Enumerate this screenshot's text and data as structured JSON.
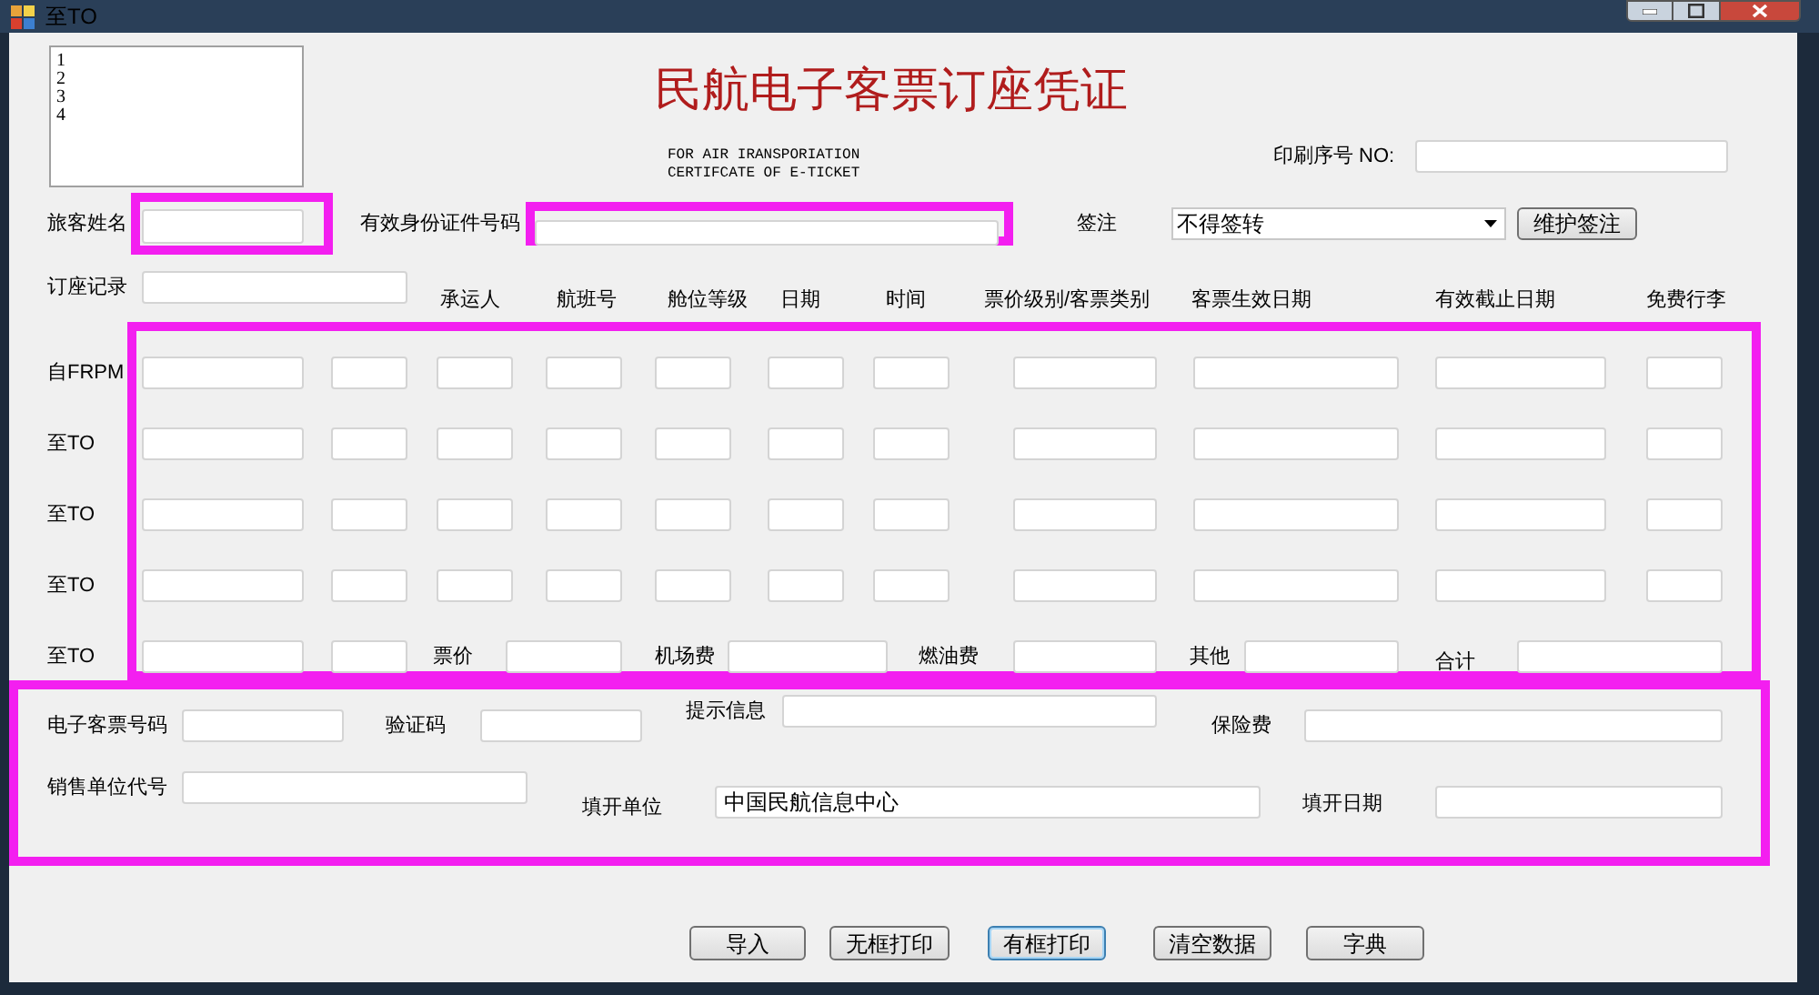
{
  "window": {
    "title": "至TO"
  },
  "list_box": {
    "items": [
      "1",
      "2",
      "3",
      "4"
    ]
  },
  "header": {
    "title": "民航电子客票订座凭证",
    "subtitle_lines": [
      "FOR AIR IRANSPORIATION",
      "CERTIFCATE OF E-TICKET"
    ]
  },
  "print_no": {
    "label": "印刷序号 NO:"
  },
  "passenger_name": {
    "label": "旅客姓名",
    "highlighted": true
  },
  "id_number": {
    "label": "有效身份证件号码",
    "highlighted": true
  },
  "endorsement": {
    "label": "签注",
    "value": "不得签转",
    "button": "维护签注"
  },
  "booking_record": {
    "label": "订座记录"
  },
  "columns": [
    "承运人",
    "航班号",
    "舱位等级",
    "日期",
    "时间",
    "票价级别/客票类别",
    "客票生效日期",
    "有效截止日期",
    "免费行李"
  ],
  "segments": {
    "highlighted": true,
    "rows": [
      {
        "label": "自FRPM"
      },
      {
        "label": "至TO"
      },
      {
        "label": "至TO"
      },
      {
        "label": "至TO"
      },
      {
        "label": "至TO"
      }
    ]
  },
  "fares": [
    {
      "label": "票价"
    },
    {
      "label": "机场费"
    },
    {
      "label": "燃油费"
    },
    {
      "label": "其他"
    },
    {
      "label": "合计"
    }
  ],
  "ticket_info": {
    "highlighted": true,
    "fields": [
      {
        "label": "电子客票号码"
      },
      {
        "label": "验证码"
      },
      {
        "label": "提示信息"
      },
      {
        "label": "保险费"
      },
      {
        "label": "销售单位代号"
      },
      {
        "label": "填开单位",
        "value": "中国民航信息中心"
      },
      {
        "label": "填开日期"
      }
    ]
  },
  "buttons": [
    {
      "label": "导入",
      "focused": false
    },
    {
      "label": "无框打印",
      "focused": false
    },
    {
      "label": "有框打印",
      "focused": true
    },
    {
      "label": "清空数据",
      "focused": false
    },
    {
      "label": "字典",
      "focused": false
    }
  ]
}
